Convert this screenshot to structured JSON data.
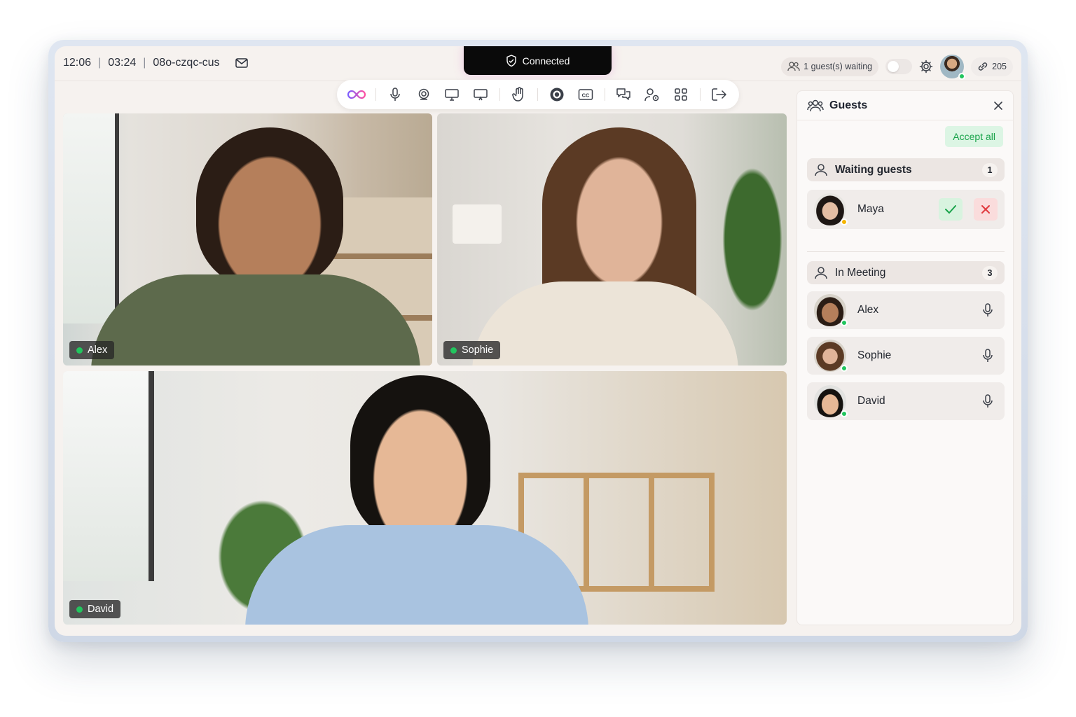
{
  "header": {
    "time": "12:06",
    "duration": "03:24",
    "meeting_code": "08o-czqc-cus",
    "status": "Connected",
    "waiting_pill": "1 guest(s) waiting",
    "participant_count": "205"
  },
  "toolbar": {
    "icons": [
      "infinity-icon",
      "microphone-icon",
      "camera-icon",
      "screen-share-icon",
      "present-icon",
      "raise-hand-icon",
      "record-icon",
      "captions-icon",
      "chat-icon",
      "people-settings-icon",
      "apps-grid-icon",
      "leave-icon"
    ]
  },
  "tiles": [
    {
      "name": "Alex"
    },
    {
      "name": "Sophie"
    },
    {
      "name": "David"
    }
  ],
  "panel": {
    "title": "Guests",
    "accept_all": "Accept all",
    "waiting": {
      "label": "Waiting guests",
      "count": "1",
      "guests": [
        {
          "name": "Maya",
          "status_color": "#f5b400"
        }
      ]
    },
    "in_meeting": {
      "label": "In Meeting",
      "count": "3",
      "people": [
        {
          "name": "Alex",
          "status_color": "#22c55e"
        },
        {
          "name": "Sophie",
          "status_color": "#22c55e"
        },
        {
          "name": "David",
          "status_color": "#22c55e"
        }
      ]
    }
  },
  "colors": {
    "accent_green": "#22c55e",
    "reject_red": "#e0393e",
    "background": "#f6f2ef"
  }
}
